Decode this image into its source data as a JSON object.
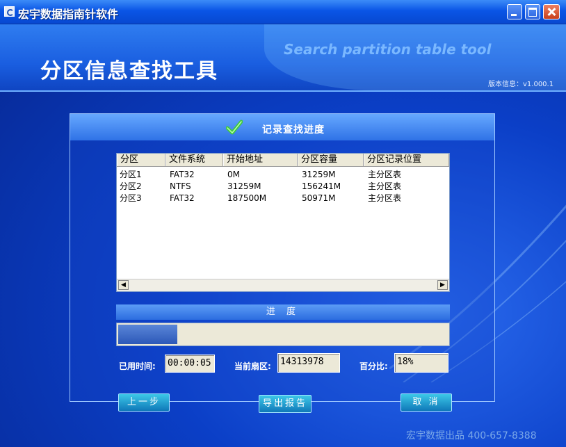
{
  "window": {
    "title": "宏宇数据指南针软件",
    "controls": [
      "minimize-icon",
      "maximize-icon",
      "close-icon"
    ]
  },
  "banner": {
    "title": "分区信息查找工具",
    "subtitle": "Search partition table tool",
    "version": "版本信息：v1.000.1"
  },
  "panel": {
    "title": "记录查找进度",
    "icon": "check-icon"
  },
  "table": {
    "columns": [
      "分区",
      "文件系统",
      "开始地址",
      "分区容量",
      "分区记录位置"
    ],
    "rows": [
      [
        "分区1",
        "FAT32",
        "0M",
        "31259M",
        "主分区表"
      ],
      [
        "分区2",
        "NTFS",
        "31259M",
        "156241M",
        "主分区表"
      ],
      [
        "分区3",
        "FAT32",
        "187500M",
        "50971M",
        "主分区表"
      ]
    ]
  },
  "progress": {
    "label": "进 度",
    "fraction": 0.18
  },
  "stats": {
    "elapsed_label": "已用时间:",
    "elapsed_value": "00:00:05",
    "sector_label": "当前扇区:",
    "sector_value": "14313978",
    "percent_label": "百分比:",
    "percent_value": "18%"
  },
  "buttons": {
    "prev": "上一步",
    "export": "导出报告",
    "cancel": "取 消"
  },
  "footer": {
    "text": "宏宇数据出品 400-657-8388"
  },
  "colors": {
    "titlebar": "#0a55e6",
    "accent_button": "#0f78b8",
    "progress_fill": "#2c58b8"
  }
}
